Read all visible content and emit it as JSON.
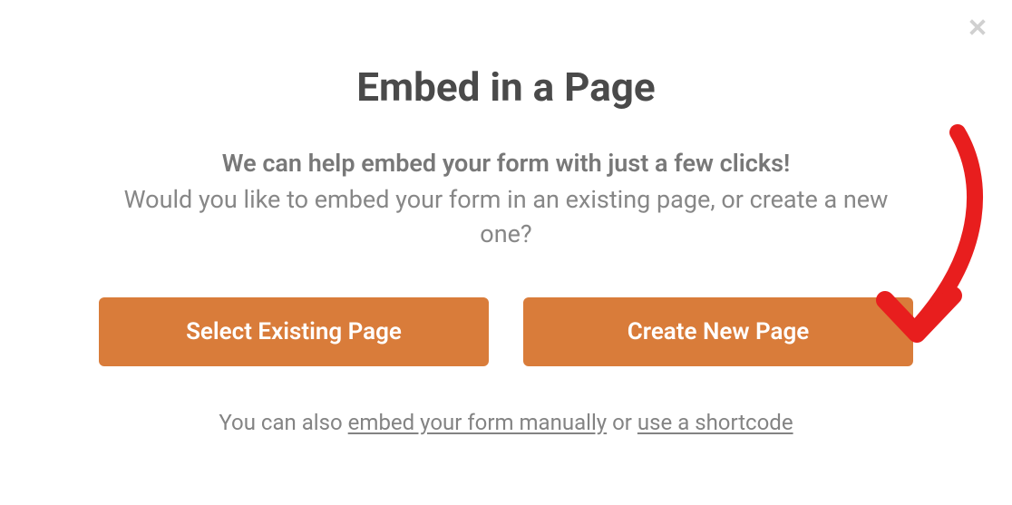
{
  "modal": {
    "title": "Embed in a Page",
    "subline1": "We can help embed your form with just a few clicks!",
    "subline2": "Would you like to embed your form in an existing page, or create a new one?",
    "buttons": {
      "select_existing": "Select Existing Page",
      "create_new": "Create New Page"
    },
    "footer": {
      "prefix": "You can also ",
      "link1": "embed your form manually",
      "middle": " or ",
      "link2": "use a shortcode"
    }
  }
}
